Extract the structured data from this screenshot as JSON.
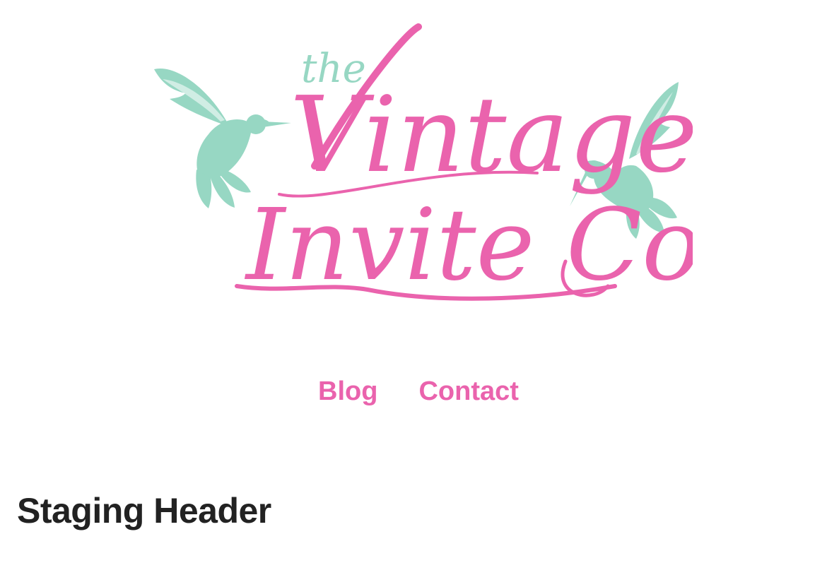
{
  "brand": {
    "logo_line_small": "the",
    "logo_line_1": "Vintage",
    "logo_line_2": "Invite Co",
    "pink": "#ea63ad",
    "mint": "#97d7c3"
  },
  "nav": {
    "items": [
      {
        "label": "Blog"
      },
      {
        "label": "Contact"
      }
    ]
  },
  "main": {
    "title": "Staging Header"
  }
}
